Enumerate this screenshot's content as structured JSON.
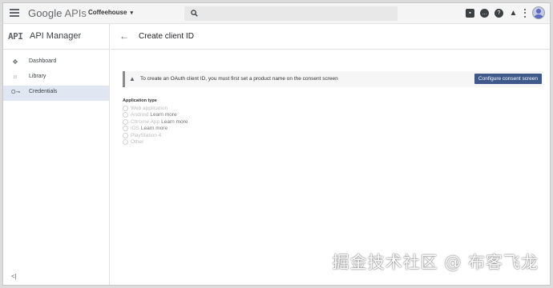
{
  "topbar": {
    "logo_google": "Google",
    "logo_apis": "APIs",
    "project_name": "Coffeehouse",
    "project_caret": "▾",
    "icons": [
      "gift-icon",
      "chat-icon",
      "help-icon",
      "bell-icon",
      "more-vert-icon",
      "avatar"
    ]
  },
  "sidebar": {
    "badge": "API",
    "title": "API Manager",
    "items": [
      {
        "label": "Dashboard",
        "icon": "dashboard-icon",
        "glyph": "✥",
        "active": false
      },
      {
        "label": "Library",
        "icon": "library-icon",
        "glyph": "⦙⦙⦙",
        "active": false
      },
      {
        "label": "Credentials",
        "icon": "key-icon",
        "glyph": "O⊸",
        "active": true
      }
    ],
    "collapse_glyph": "<|"
  },
  "main": {
    "back_glyph": "←",
    "title": "Create client ID",
    "alert": {
      "icon": "warning-icon",
      "glyph": "▲",
      "message": "To create an OAuth client ID, you must first set a product name on the consent screen",
      "button_label": "Configure consent screen"
    },
    "app_type": {
      "label": "Application type",
      "options": [
        {
          "label": "Web application",
          "link": ""
        },
        {
          "label": "Android",
          "link": "Learn more"
        },
        {
          "label": "Chrome App",
          "link": "Learn more"
        },
        {
          "label": "iOS",
          "link": "Learn more"
        },
        {
          "label": "PlayStation 4",
          "link": ""
        },
        {
          "label": "Other",
          "link": ""
        }
      ]
    }
  },
  "watermark": "掘金技术社区 @ 布客飞龙",
  "colors": {
    "accent_button": "#3f5a8a",
    "active_nav": "#e1e7f2",
    "topbar_bg": "#f5f5f5"
  }
}
